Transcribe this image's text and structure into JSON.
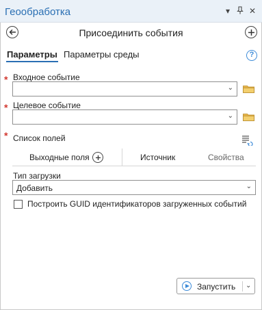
{
  "window": {
    "title": "Геообработка",
    "controls": [
      "chevron-down-icon",
      "pin-icon",
      "close-icon"
    ]
  },
  "header": {
    "title": "Присоединить события",
    "back_icon": "back-arrow-icon",
    "add_icon": "plus-circle-icon"
  },
  "tabs": [
    {
      "label": "Параметры",
      "active": true
    },
    {
      "label": "Параметры среды",
      "active": false
    }
  ],
  "help_icon_text": "?",
  "params": {
    "input_event": {
      "label": "Входное событие",
      "required": true,
      "value": ""
    },
    "target_event": {
      "label": "Целевое событие",
      "required": true,
      "value": ""
    },
    "field_list": {
      "label": "Список полей",
      "required": true,
      "tabs": [
        "Выходные поля",
        "Источник",
        "Свойства"
      ]
    },
    "load_type": {
      "label": "Тип загрузки",
      "value": "Добавить"
    },
    "build_guid": {
      "label": "Построить GUID идентификаторов загруженных событий",
      "checked": false
    }
  },
  "run_button": {
    "label": "Запустить"
  },
  "colors": {
    "accent": "#2a6fb3",
    "required": "#d2372f",
    "folder": "#e8b64b"
  }
}
